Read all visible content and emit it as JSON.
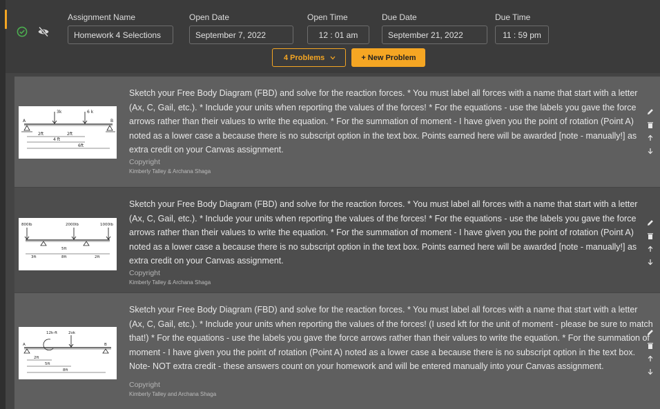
{
  "header": {
    "fields": [
      {
        "label": "Assignment Name",
        "value": "Homework 4 Selections"
      },
      {
        "label": "Open Date",
        "value": "September 7, 2022"
      },
      {
        "label": "Open Time",
        "value": "12 : 01 am"
      },
      {
        "label": "Due Date",
        "value": "September 21, 2022"
      },
      {
        "label": "Due Time",
        "value": "11 : 59 pm"
      }
    ],
    "problems_button": "4 Problems",
    "new_problem_button": "+ New Problem"
  },
  "problems": [
    {
      "text": "Sketch your Free Body Diagram (FBD) and solve for the reaction forces. * You must label all forces with a name that start with a letter (Ax, C, Gail, etc.). * Include your units when reporting the values of the forces! * For the equations - use the labels you gave the force arrows rather than their values to write the equation. * For the summation of moment - I have given you the point of rotation (Point A) noted as a lower case a because there is no subscript option in the text box. Points earned here will be awarded [note - manually!] as extra credit on your Canvas assignment.",
      "copyright": "Copyright",
      "authors": "Kimberly Talley & Archana Shaga",
      "diagram_labels": [
        "3k",
        "6 k",
        "A",
        "B",
        "2ft",
        "2ft",
        "4 ft",
        "6ft"
      ]
    },
    {
      "text": "Sketch your Free Body Diagram (FBD) and solve for the reaction forces. * You must label all forces with a name that start with a letter (Ax, C, Gail, etc.). * Include your units when reporting the values of the forces! * For the equations - use the labels you gave the force arrows rather than their values to write the equation. * For the summation of moment - I have given you the point of rotation (Point A) noted as a lower case a because there is no subscript option in the text box. Points earned here will be awarded [note - manually!] as extra credit on your Canvas assignment.",
      "copyright": "Copyright",
      "authors": "Kimberly Talley & Archana Shaga",
      "diagram_labels": [
        "800lb",
        "2000lb",
        "1000lb",
        "5ft",
        "3ft",
        "8ft",
        "2ft"
      ]
    },
    {
      "text": "Sketch your Free Body Diagram (FBD) and solve for the reaction forces. * You must label all forces with a name that start with a letter (Ax, C, Gail, etc.). * Include your units when reporting the values of the forces! (I used kft for the unit of moment - please be sure to match that!) * For the equations - use the labels you gave the force arrows rather than their values to write the equation. * For the summation of moment - I have given you the point of rotation (Point A) noted as a lower case a because there is no subscript option in the text box. Note- NOT extra credit - these answers count on your homework and will be entered manually into your Canvas assignment.",
      "copyright": "Copyright",
      "authors": "Kimberly Talley and Archana Shaga",
      "diagram_labels": [
        "12k-ft",
        "2ok",
        "A",
        "B",
        "2ft",
        "5ft",
        "8ft"
      ]
    }
  ],
  "icons": {
    "status_ok": "check-circle-icon",
    "visibility": "eye-off-icon",
    "edit": "pencil-icon",
    "delete": "trash-icon",
    "move_up": "arrow-up-icon",
    "move_down": "arrow-down-icon"
  },
  "colors": {
    "accent": "#f5a623",
    "success": "#4caf50"
  }
}
